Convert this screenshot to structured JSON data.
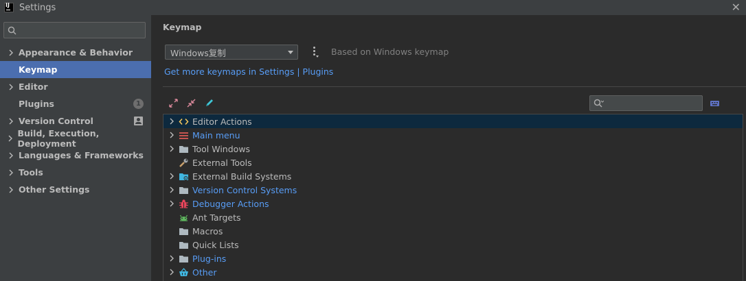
{
  "window": {
    "title": "Settings"
  },
  "search": {
    "placeholder": "",
    "value": ""
  },
  "sidebar": {
    "items": [
      {
        "label": "Appearance & Behavior",
        "expandable": true
      },
      {
        "label": "Keymap",
        "expandable": false,
        "selected": true
      },
      {
        "label": "Editor",
        "expandable": true
      },
      {
        "label": "Plugins",
        "expandable": false,
        "badge": "1"
      },
      {
        "label": "Version Control",
        "expandable": true
      },
      {
        "label": "Build, Execution, Deployment",
        "expandable": true
      },
      {
        "label": "Languages & Frameworks",
        "expandable": true
      },
      {
        "label": "Tools",
        "expandable": true
      },
      {
        "label": "Other Settings",
        "expandable": true
      }
    ]
  },
  "main": {
    "title": "Keymap",
    "keymap_selected": "Windows复制",
    "based_on": "Based on Windows keymap",
    "get_more_link": "Get more keymaps in Settings | Plugins",
    "shortcut_search_value": ""
  },
  "tree": {
    "rows": [
      {
        "label": "Editor Actions",
        "expandable": true,
        "icon": "code-brackets-icon",
        "blue": false,
        "selected": true
      },
      {
        "label": "Main menu",
        "expandable": true,
        "icon": "menu-icon",
        "blue": true
      },
      {
        "label": "Tool Windows",
        "expandable": true,
        "icon": "folder-icon",
        "blue": false
      },
      {
        "label": "External Tools",
        "expandable": false,
        "icon": "wrench-icon",
        "blue": false
      },
      {
        "label": "External Build Systems",
        "expandable": true,
        "icon": "build-folder-icon",
        "blue": false
      },
      {
        "label": "Version Control Systems",
        "expandable": true,
        "icon": "folder-icon",
        "blue": true
      },
      {
        "label": "Debugger Actions",
        "expandable": true,
        "icon": "bug-icon",
        "blue": true
      },
      {
        "label": "Ant Targets",
        "expandable": false,
        "icon": "ant-icon",
        "blue": false
      },
      {
        "label": "Macros",
        "expandable": false,
        "icon": "folder-icon",
        "blue": false
      },
      {
        "label": "Quick Lists",
        "expandable": false,
        "icon": "folder-icon",
        "blue": false
      },
      {
        "label": "Plug-ins",
        "expandable": true,
        "icon": "folder-icon",
        "blue": true
      },
      {
        "label": "Other",
        "expandable": true,
        "icon": "basket-icon",
        "blue": true
      }
    ]
  },
  "colors": {
    "accent": "#4b6eaf",
    "link": "#589df6",
    "tree_selection": "#0d293e"
  }
}
